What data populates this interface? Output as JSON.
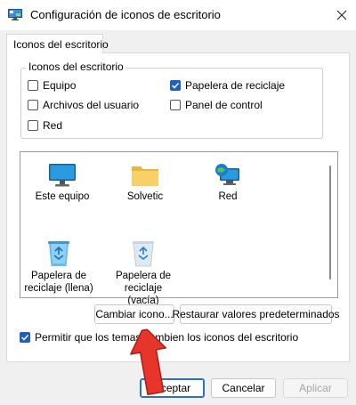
{
  "window": {
    "title": "Configuración de iconos de escritorio",
    "icon": "desktop-settings-icon"
  },
  "tabs": [
    {
      "label": "Iconos del escritorio",
      "active": true
    }
  ],
  "desktop_icons_group": {
    "title": "Iconos del escritorio",
    "checkboxes": [
      {
        "label": "Equipo",
        "checked": false
      },
      {
        "label": "Papelera de reciclaje",
        "checked": true
      },
      {
        "label": "Archivos del usuario",
        "checked": false
      },
      {
        "label": "Panel de control",
        "checked": false
      },
      {
        "label": "Red",
        "checked": false
      }
    ]
  },
  "icon_list": {
    "items": [
      {
        "label": "Este equipo",
        "icon": "monitor-icon",
        "selected": false
      },
      {
        "label": "Solvetic",
        "icon": "folder-icon",
        "selected": false
      },
      {
        "label": "Red",
        "icon": "network-icon",
        "selected": false
      },
      {
        "label": "Papelera de reciclaje (llena)",
        "icon": "recycle-bin-full-icon",
        "selected": true
      },
      {
        "label": "Papelera de reciclaje (vacía)",
        "icon": "recycle-bin-empty-icon",
        "selected": false
      }
    ]
  },
  "buttons": {
    "change_icon": "Cambiar icono...",
    "restore_defaults": "Restaurar valores predeterminados",
    "accept": "Aceptar",
    "cancel": "Cancelar",
    "apply": "Aplicar"
  },
  "allow_themes": {
    "label": "Permitir que los temas cambien los iconos del escritorio",
    "checked": true
  },
  "colors": {
    "accent": "#0a64c8",
    "arrow": "#e8352b"
  }
}
